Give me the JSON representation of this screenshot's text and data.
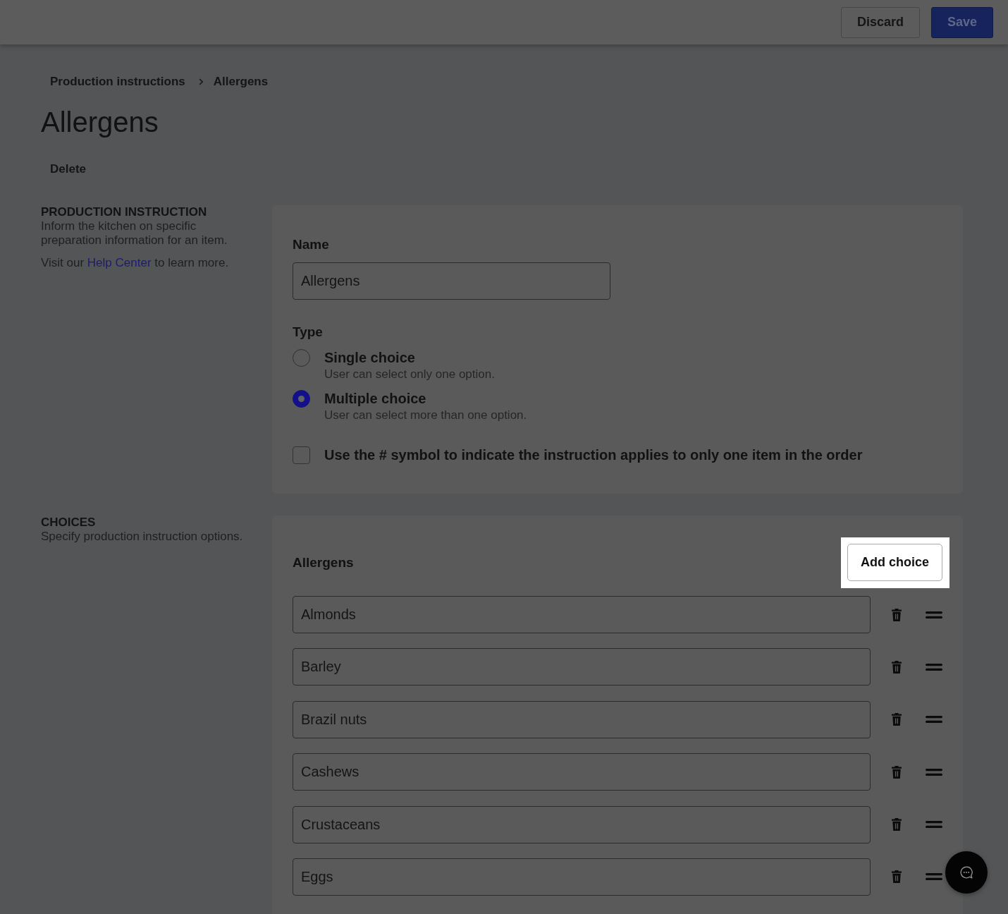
{
  "top_bar": {
    "buttons": [
      {
        "label": "Discard",
        "kind": "secondary"
      },
      {
        "label": "Save",
        "kind": "primary"
      }
    ]
  },
  "breadcrumb": [
    "Production instructions",
    "Allergens"
  ],
  "page_title": "Allergens",
  "delete_label": "Delete",
  "instruction_section": {
    "heading": "PRODUCTION INSTRUCTION",
    "description": "Inform the kitchen on specific preparation information for an item.",
    "help_text": {
      "before": "Visit our ",
      "link": "Help Center",
      "after": " to learn more."
    },
    "name_field": {
      "label": "Name",
      "value": "Allergens"
    },
    "type_field": {
      "label": "Type",
      "options": [
        {
          "title": "Single choice",
          "description": "User can select only one option.",
          "selected": false
        },
        {
          "title": "Multiple choice",
          "description": "User can select more than one option.",
          "selected": true
        }
      ]
    },
    "single_item_checkbox": {
      "label": "Use the # symbol to indicate the instruction applies to only one item in the order",
      "checked": false
    }
  },
  "choices_section": {
    "heading": "CHOICES",
    "description": "Specify production instruction options.",
    "list_title": "Allergens",
    "add_button": {
      "label": "Add choice",
      "highlighted": true
    },
    "choices": [
      {
        "value": "Almonds"
      },
      {
        "value": "Barley"
      },
      {
        "value": "Brazil nuts"
      },
      {
        "value": "Cashews"
      },
      {
        "value": "Crustaceans"
      },
      {
        "value": "Eggs"
      }
    ]
  }
}
